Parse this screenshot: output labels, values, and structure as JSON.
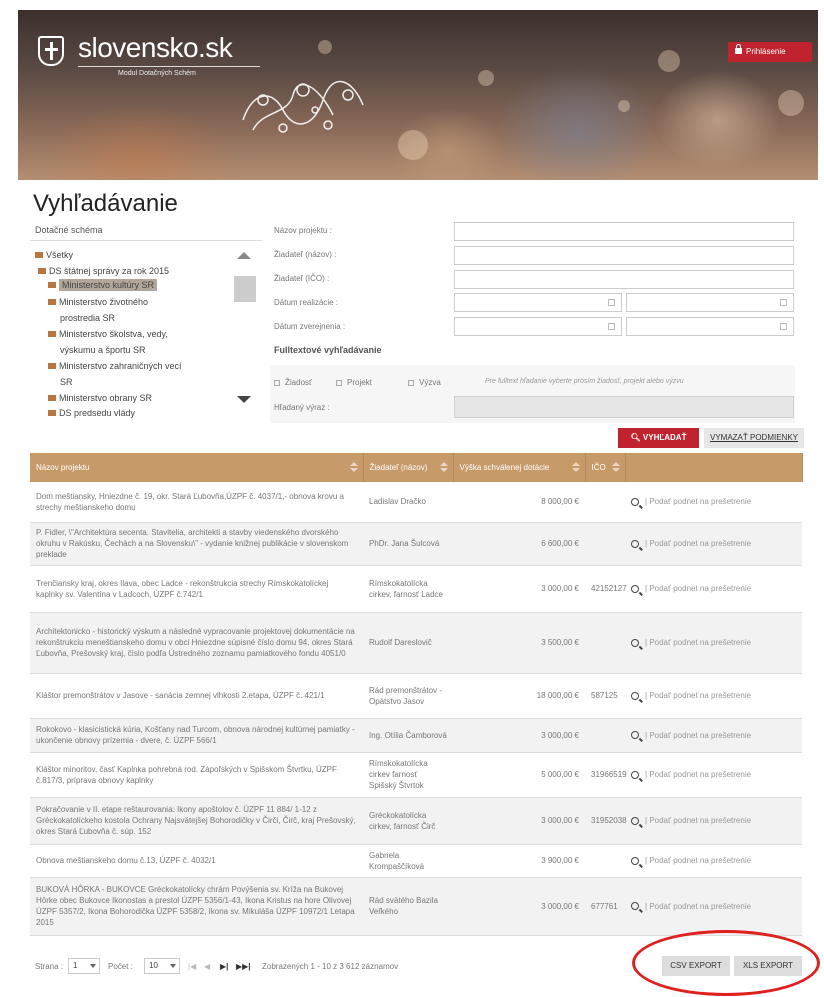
{
  "header": {
    "logo_text": "slovensko.sk",
    "logo_subtitle": "Modul Dotačných Schém",
    "login_label": "Prihlásenie"
  },
  "search": {
    "title": "Vyhľadávanie",
    "tree_label": "Dotačné schéma",
    "tree_items": [
      "Všetky",
      "DS štátnej správy za rok 2015",
      "Ministerstvo kultúry SR",
      "Ministerstvo životného",
      "prostredia SR",
      "Ministerstvo školstva, vedy,",
      "výskumu a športu SR",
      "Ministerstvo zahraničných vecí",
      "SR",
      "Ministerstvo obrany SR",
      "DS predsedu vlády"
    ],
    "fields": {
      "project_name": "Názov projektu :",
      "applicant_name": "Žiadateľ (názov) :",
      "applicant_ico": "Žiadateľ (IČO) :",
      "realization_date": "Dátum realizácie :",
      "publication_date": "Dátum zverejnenia :"
    },
    "fulltext_title": "Fulltextové vyhľadávanie",
    "checkboxes": [
      "Žiadosť",
      "Projekt",
      "Výzva"
    ],
    "fulltext_hint": "Pre fulltext hľadanie vyberte prosím žiadosť, projekt alebo výzvu",
    "search_expr_label": "Hľadaný výraz :",
    "search_button": "VYHĽADAŤ",
    "clear_button": "VYMAZAŤ PODMIENKY"
  },
  "table": {
    "headers": [
      "Názov projektu",
      "Žiadateľ (názov)",
      "Výška schválenej dotácie",
      "IČO"
    ],
    "action_label": "Podať podnet na prešetrenie",
    "rows": [
      {
        "name": "Dom meštiansky, Hniezdne č. 19, okr. Stará Ľubovňa,ÚZPF č. 4037/1,- obnova krovu a strechy meštianskeho domu",
        "applicant": "Ladislav Dračko",
        "amount": "8 000,00 €",
        "ico": ""
      },
      {
        "name": "P. Fidler, \\\"Architektúra secenta. Stavitelia, architekti a stavby viedenského dvorského okruhu v Rakúsku, Čechách a na Slovensku\\\" - vydanie knižnej publikácie v slovenskom preklade",
        "applicant": "PhDr. Jana Šulcová",
        "amount": "6 600,00 €",
        "ico": ""
      },
      {
        "name": "Trenčiansky kraj, okres Ilava, obec Ladce - rekonštrukcia strechy Rímskokatolíckej kaplnky sv. Valentína v Ladcoch, ÚZPF č.742/1",
        "applicant": "Rímskokatolícka cirkev, farnosť Ladce",
        "amount": "3 000,00 €",
        "ico": "42152127"
      },
      {
        "name": "Architektonicko - historický výskum a následné vypracovanie projektovej dokumentácie na rekonštrukciu meneštianskeho domu v obci Hniezdne súpisné číslo domu 94, okres Stará Ľubovňa, Prešovský kraj, číslo podľa Ústredného zoznamu pamiatkového fondu 4051/0",
        "applicant": "Rudolf Dareslovič",
        "amount": "3 500,00 €",
        "ico": ""
      },
      {
        "name": "Kláštor premonštrátov v Jasove - sanácia zemnej vlhkosti 2.etapa, ÚZPF č. 421/1",
        "applicant": "Rád premonštrátov - Opátstvo Jasov",
        "amount": "18 000,00 €",
        "ico": "587125"
      },
      {
        "name": "Rokokovo - klasicistická kúria, Košťany nad Turcom, obnova národnej kultúrnej pamiatky - ukončenie obnovy prízemia - dvere, č. ÚZPF 566/1",
        "applicant": "Ing. Otília Čamborová",
        "amount": "3 000,00 €",
        "ico": ""
      },
      {
        "name": "Kláštor minoritov, časť Kaplnka pohrebná rod. Zápoľských v Spišskom Štvrtku, ÚZPF č.817/3, príprava obnovy kaplnky",
        "applicant": "Rímskokatolícka cirkev farnosť Spišský Štvrtok",
        "amount": "5 000,00 €",
        "ico": "31966519"
      },
      {
        "name": "Pokračovanie v II. etape reštaurovania: Ikony apoštolov č. ÚZPF 11 884/ 1-12 z Gréckokatolíckeho kostola Ochrany Najsvätejšej Bohorodičky v Čirči, Čirč, kraj Prešovský, okres Stará Ľubovňa č. súp. 152",
        "applicant": "Gréckokatolícka cirkev, farnosť Čirč",
        "amount": "3 000,00 €",
        "ico": "31952038"
      },
      {
        "name": "Obnova meštianskeho domu č.13, ÚZPF č. 4032/1",
        "applicant": "Gabriela Krompaščíková",
        "amount": "3 900,00 €",
        "ico": ""
      },
      {
        "name": "BUKOVÁ HÔRKA - BUKOVCE Gréckokatolícky chrám Povýšenia sv. Kríža na Bukovej Hôrke obec Bukovce Ikonostas a prestol ÚZPF 5356/1-43, Ikona Kristus na hore Olivovej ÚZPF 5357/2, Ikona Bohorodička ÚZPF 5358/2, Ikona sv. Mikuláša ÚZPF 10972/1 Letapa 2015",
        "applicant": "Rád svätého Bazila Veľkého",
        "amount": "3 000,00 €",
        "ico": "677761"
      }
    ]
  },
  "pager": {
    "page_label": "Strana :",
    "page_value": "1",
    "count_label": "Počet :",
    "count_value": "10",
    "summary": "Zobrazených 1 - 10 z 3 612 záznamov",
    "csv_export": "CSV EXPORT",
    "xls_export": "XLS EXPORT"
  },
  "colors": {
    "accent_red": "#c0232e",
    "table_header": "#c79a6a",
    "highlight_ellipse": "#e01f1f"
  }
}
